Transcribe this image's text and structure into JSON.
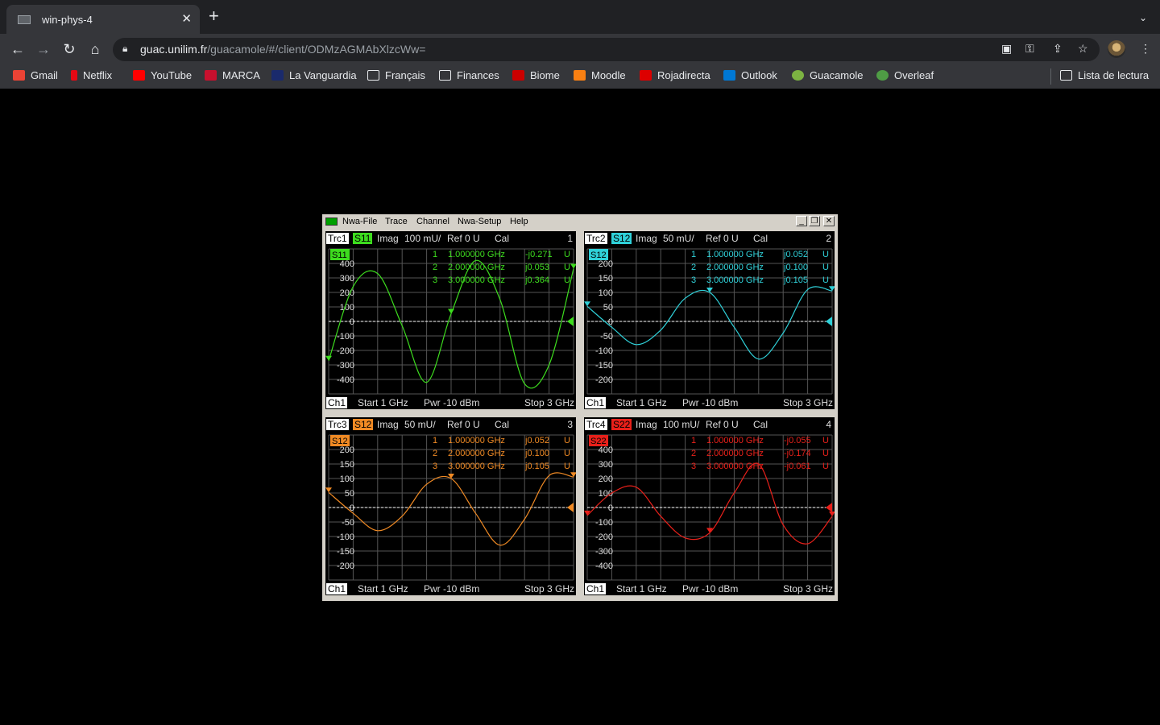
{
  "browser": {
    "tab_title": "win-phys-4",
    "url_host": "guac.unilim.fr",
    "url_path": "/guacamole/#/client/ODMzAGMAbXlzcWw=",
    "bookmarks": [
      "Gmail",
      "Netflix",
      "YouTube",
      "MARCA",
      "La Vanguardia",
      "Français",
      "Finances",
      "Biome",
      "Moodle",
      "Rojadirecta",
      "Outlook",
      "Guacamole",
      "Overleaf"
    ],
    "reading_list": "Lista de lectura"
  },
  "vna": {
    "menu": [
      "Nwa-File",
      "Trace",
      "Channel",
      "Nwa-Setup",
      "Help"
    ],
    "footer": {
      "ch": "Ch1",
      "start": "Start  1 GHz",
      "pwr": "Pwr  -10 dBm",
      "stop": "Stop  3 GHz"
    },
    "panels": [
      {
        "trc": "Trc1",
        "param": "S11",
        "fmt": "Imag",
        "scale": "100 mU/",
        "ref": "Ref 0 U",
        "cal": "Cal",
        "num": "1",
        "color": "#3ddc1e",
        "ticks": [
          "400",
          "300",
          "200",
          "100",
          "0",
          "-100",
          "-200",
          "-300",
          "-400"
        ],
        "markers": [
          {
            "n": "1",
            "f": "1.000000 GHz",
            "v": "-j0.271",
            "u": "U"
          },
          {
            "n": "2",
            "f": "2.000000 GHz",
            "v": "j0.053",
            "u": "U"
          },
          {
            "n": "3",
            "f": "3.000000 GHz",
            "v": "j0.364",
            "u": "U"
          }
        ]
      },
      {
        "trc": "Trc2",
        "param": "S12",
        "fmt": "Imag",
        "scale": "50 mU/",
        "ref": "Ref 0 U",
        "cal": "Cal",
        "num": "2",
        "color": "#2fd0d8",
        "ticks": [
          "200",
          "150",
          "100",
          "50",
          "0",
          "-50",
          "-100",
          "-150",
          "-200"
        ],
        "markers": [
          {
            "n": "1",
            "f": "1.000000 GHz",
            "v": "j0.052",
            "u": "U"
          },
          {
            "n": "2",
            "f": "2.000000 GHz",
            "v": "j0.100",
            "u": "U"
          },
          {
            "n": "3",
            "f": "3.000000 GHz",
            "v": "j0.105",
            "u": "U"
          }
        ]
      },
      {
        "trc": "Trc3",
        "param": "S12",
        "fmt": "Imag",
        "scale": "50 mU/",
        "ref": "Ref 0 U",
        "cal": "Cal",
        "num": "3",
        "color": "#f08a24",
        "ticks": [
          "200",
          "150",
          "100",
          "50",
          "0",
          "-50",
          "-100",
          "-150",
          "-200"
        ],
        "markers": [
          {
            "n": "1",
            "f": "1.000000 GHz",
            "v": "j0.052",
            "u": "U"
          },
          {
            "n": "2",
            "f": "2.000000 GHz",
            "v": "j0.100",
            "u": "U"
          },
          {
            "n": "3",
            "f": "3.000000 GHz",
            "v": "j0.105",
            "u": "U"
          }
        ]
      },
      {
        "trc": "Trc4",
        "param": "S22",
        "fmt": "Imag",
        "scale": "100 mU/",
        "ref": "Ref 0 U",
        "cal": "Cal",
        "num": "4",
        "color": "#e8201a",
        "ticks": [
          "400",
          "300",
          "200",
          "100",
          "0",
          "-100",
          "-200",
          "-300",
          "-400"
        ],
        "markers": [
          {
            "n": "1",
            "f": "1.000000 GHz",
            "v": "-j0.055",
            "u": "U"
          },
          {
            "n": "2",
            "f": "2.000000 GHz",
            "v": "-j0.174",
            "u": "U"
          },
          {
            "n": "3",
            "f": "3.000000 GHz",
            "v": "-j0.061",
            "u": "U"
          }
        ]
      }
    ]
  },
  "chart_data": [
    {
      "type": "line",
      "title": "Trc1 S11 Imag",
      "xlabel": "",
      "ylabel": "",
      "xlim_ghz": [
        1,
        3
      ],
      "ylim": [
        -500,
        500
      ],
      "series": [
        {
          "name": "S11",
          "x": [
            1.0,
            1.2,
            1.4,
            1.6,
            1.8,
            2.0,
            2.2,
            2.4,
            2.6,
            2.8,
            3.0
          ],
          "values": [
            -271,
            240,
            330,
            -30,
            -420,
            53,
            420,
            150,
            -430,
            -300,
            364
          ]
        }
      ]
    },
    {
      "type": "line",
      "title": "Trc2 S12 Imag",
      "xlabel": "",
      "ylabel": "",
      "xlim_ghz": [
        1,
        3
      ],
      "ylim": [
        -250,
        250
      ],
      "series": [
        {
          "name": "S12",
          "x": [
            1.0,
            1.2,
            1.4,
            1.6,
            1.8,
            2.0,
            2.2,
            2.4,
            2.6,
            2.8,
            3.0
          ],
          "values": [
            52,
            -20,
            -80,
            -30,
            80,
            100,
            -20,
            -130,
            -40,
            110,
            105
          ]
        }
      ]
    },
    {
      "type": "line",
      "title": "Trc3 S12 Imag",
      "xlabel": "",
      "ylabel": "",
      "xlim_ghz": [
        1,
        3
      ],
      "ylim": [
        -250,
        250
      ],
      "series": [
        {
          "name": "S12",
          "x": [
            1.0,
            1.2,
            1.4,
            1.6,
            1.8,
            2.0,
            2.2,
            2.4,
            2.6,
            2.8,
            3.0
          ],
          "values": [
            52,
            -20,
            -80,
            -30,
            80,
            100,
            -20,
            -130,
            -40,
            110,
            105
          ]
        }
      ]
    },
    {
      "type": "line",
      "title": "Trc4 S22 Imag",
      "xlabel": "",
      "ylabel": "",
      "xlim_ghz": [
        1,
        3
      ],
      "ylim": [
        -500,
        500
      ],
      "series": [
        {
          "name": "S22",
          "x": [
            1.0,
            1.2,
            1.4,
            1.6,
            1.8,
            2.0,
            2.2,
            2.4,
            2.6,
            2.8,
            3.0
          ],
          "values": [
            -55,
            100,
            140,
            -60,
            -210,
            -174,
            100,
            300,
            -120,
            -250,
            -61
          ]
        }
      ]
    }
  ]
}
